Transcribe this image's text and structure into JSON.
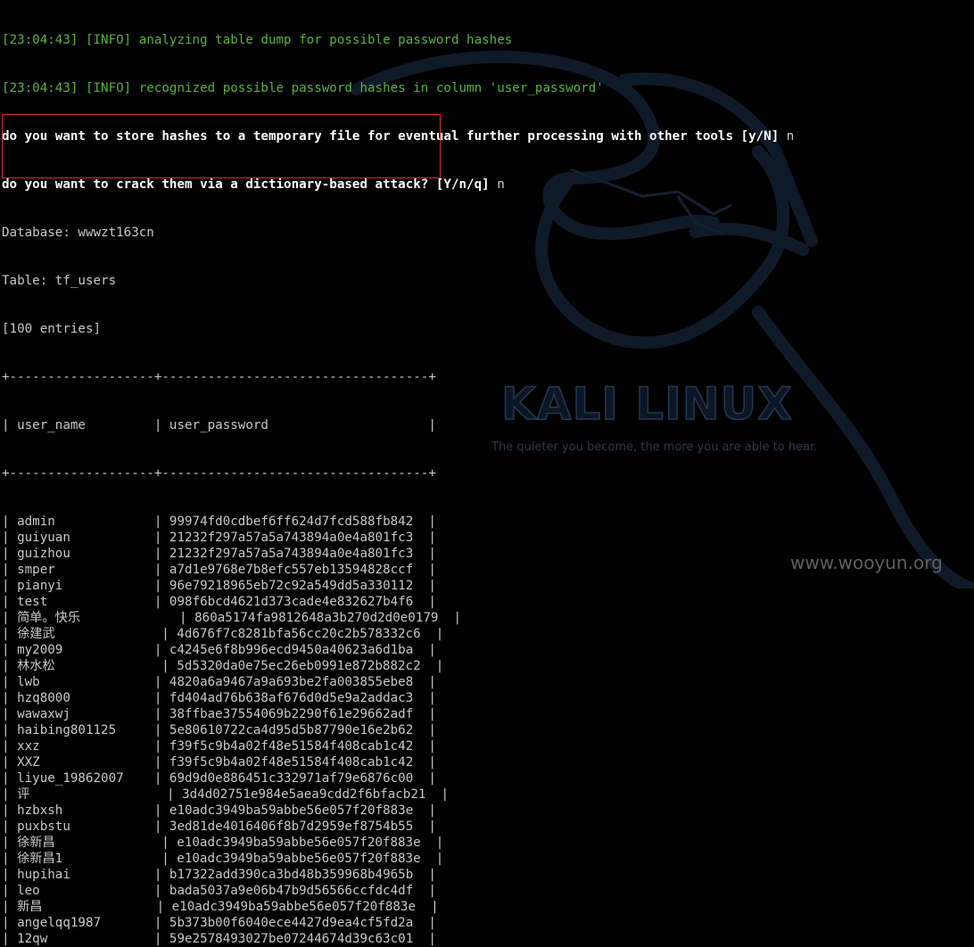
{
  "log_lines": [
    "[23:04:43] [INFO] analyzing table dump for possible password hashes",
    "[23:04:43] [INFO] recognized possible password hashes in column 'user_password'"
  ],
  "prompts": [
    {
      "question": "do you want to store hashes to a temporary file for eventual further processing with other tools [y/N]",
      "answer": " n"
    },
    {
      "question": "do you want to crack them via a dictionary-based attack? [Y/n/q]",
      "answer": " n"
    }
  ],
  "database_line": "Database: wwwzt163cn",
  "table_line": "Table: tf_users",
  "entries_line": "[100 entries]",
  "table_border": "+-------------------+-----------------------------------+",
  "header_row": "| user_name         | user_password                     |",
  "rows": [
    "| admin             | 99974fd0cdbef6ff624d7fcd588fb842  |",
    "| guiyuan           | 21232f297a57a5a743894a0e4a801fc3  |",
    "| guizhou           | 21232f297a57a5a743894a0e4a801fc3  |",
    "| smper             | a7d1e9768e7b8efc557eb13594828ccf  |",
    "| pianyi            | 96e79218965eb72c92a549dd5a330112  |",
    "| test              | 098f6bcd4621d373cade4e832627b4f6  |",
    "| 简单。快乐             | 860a5174fa9812648a3b270d2d0e0179  |",
    "| 徐建武              | 4d676f7c8281bfa56cc20c2b578332c6  |",
    "| my2009            | c4245e6f8b996ecd9450a40623a6d1ba  |",
    "| 林水松              | 5d5320da0e75ec26eb0991e872b882c2  |",
    "| lwb               | 4820a6a9467a9a693be2fa003855ebe8  |",
    "| hzq8000           | fd404ad76b638af676d0d5e9a2addac3  |",
    "| wawaxwj           | 38ffbae37554069b2290f61e29662adf  |",
    "| haibing801125     | 5e80610722ca4d95d5b87790e16e2b62  |",
    "| xxz               | f39f5c9b4a02f48e51584f408cab1c42  |",
    "| XXZ               | f39f5c9b4a02f48e51584f408cab1c42  |",
    "| liyue_19862007    | 69d9d0e886451c332971af79e6876c00  |",
    "| 评                  | 3d4d02751e984e5aea9cdd2f6bfacb21  |",
    "| hzbxsh            | e10adc3949ba59abbe56e057f20f883e  |",
    "| puxbstu           | 3ed81de4016406f8b7d2959ef8754b55  |",
    "| 徐新昌              | e10adc3949ba59abbe56e057f20f883e  |",
    "| 徐新昌1             | e10adc3949ba59abbe56e057f20f883e  |",
    "| hupihai           | b17322add390ca3bd48b359968b4965b  |",
    "| leo               | bada5037a9e06b47b9d56566ccfdc4df  |",
    "| 新昌               | e10adc3949ba59abbe56e057f20f883e  |",
    "| angelqq1987       | 5b373b00f6040ece4427d9ea4cf5fd2a  |",
    "| 12qw              | 59e2578493027be07244674d39c63c01  |"
  ],
  "kali_title": "KALI LINUX",
  "kali_tagline": "The quieter you become, the more you are able to hear.",
  "watermark": "www.wooyun.org",
  "colors": {
    "background": "#000000",
    "log_text": "#59b23c",
    "prompt_text": "#ffffff",
    "table_text": "#c8c8c8",
    "highlight_border": "#d42d2d",
    "logo_stroke": "#26384f"
  }
}
